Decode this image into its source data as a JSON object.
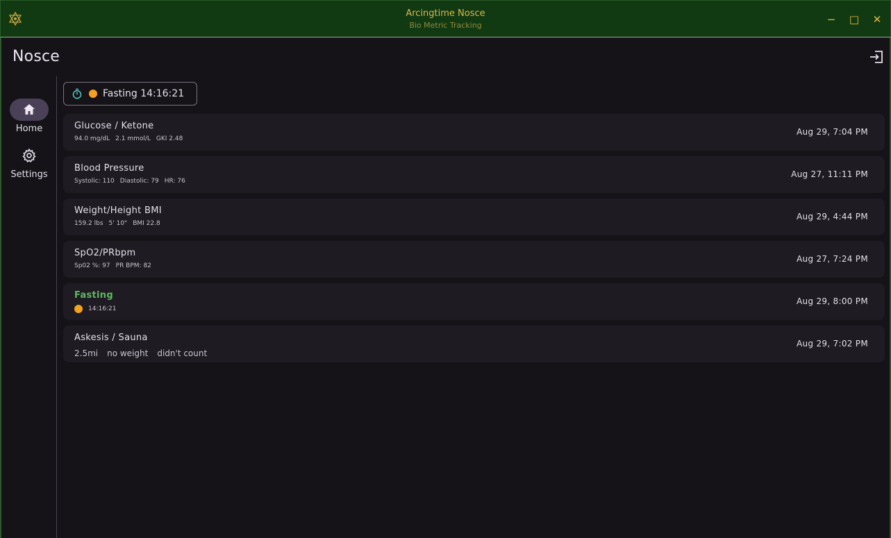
{
  "window": {
    "title": "Arcingtime Nosce",
    "subtitle": "Bio Metric Tracking",
    "minimize_glyph": "−",
    "maximize_glyph": "□",
    "close_glyph": "✕"
  },
  "header": {
    "title": "Nosce",
    "logout_icon": "logout-icon"
  },
  "nav": {
    "items": [
      {
        "label": "Home",
        "icon": "home-icon",
        "selected": true
      },
      {
        "label": "Settings",
        "icon": "gear-icon",
        "selected": false
      }
    ]
  },
  "fasting_chip": {
    "icon": "timer-icon",
    "label": "Fasting 14:16:21",
    "status_color": "#f6a21a"
  },
  "cards": [
    {
      "name": "Glucose / Ketone",
      "details": [
        "94.0 mg/dL",
        "2.1 mmol/L",
        "GKI 2.48"
      ],
      "date": "Aug 29, 7:04 PM"
    },
    {
      "name": "Blood Pressure",
      "details": [
        "Systolic: 110",
        "Diastolic: 79",
        "HR: 76"
      ],
      "date": "Aug 27, 11:11 PM"
    },
    {
      "name": "Weight/Height BMI",
      "details": [
        "159.2 lbs",
        "5' 10\"",
        "BMI 22.8"
      ],
      "date": "Aug 29, 4:44 PM"
    },
    {
      "name": "SpO2/PRbpm",
      "details": [
        "Sp02 %: 97",
        "PR BPM: 82"
      ],
      "date": "Aug 27, 7:24 PM"
    },
    {
      "name": "Fasting",
      "details": [
        "14:16:21"
      ],
      "date": "Aug 29, 8:00 PM"
    },
    {
      "name": "Askesis / Sauna",
      "details": [
        "2.5mi",
        "no weight",
        "didn't count"
      ],
      "date": "Aug 29, 7:02 PM"
    }
  ],
  "colors": {
    "accent_green": "#5fb85f",
    "fasting_orange": "#f6a21a",
    "titlebar_bg": "#123a12",
    "title_gold": "#d9b84a"
  }
}
